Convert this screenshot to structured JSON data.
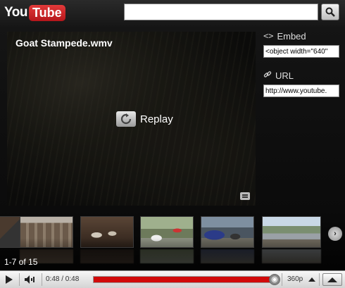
{
  "header": {
    "logo_you": "You",
    "logo_tube": "Tube",
    "search_value": ""
  },
  "video": {
    "title": "Goat Stampede.wmv",
    "replay_label": "Replay"
  },
  "share": {
    "embed_label": "Embed",
    "embed_value": "<object width=\"640\"",
    "url_label": "URL",
    "url_value": "http://www.youtube."
  },
  "related": {
    "counter": "1-7 of 15",
    "thumbnails": [
      {
        "icon": "video-thumbnail-street",
        "color": "#6b5a4a"
      },
      {
        "icon": "video-thumbnail-goats-pen",
        "color": "#4a3b30"
      },
      {
        "icon": "video-thumbnail-goats-yard",
        "color": "#7c8b6e"
      },
      {
        "icon": "video-thumbnail-goats-field",
        "color": "#3f4a68"
      },
      {
        "icon": "video-thumbnail-goats-road",
        "color": "#8a9aa5"
      }
    ]
  },
  "controls": {
    "time": "0:48 / 0:48",
    "progress": 1.0,
    "quality": "360p"
  },
  "colors": {
    "progress": "#d10a0a",
    "logo_red": "#cc181e"
  }
}
